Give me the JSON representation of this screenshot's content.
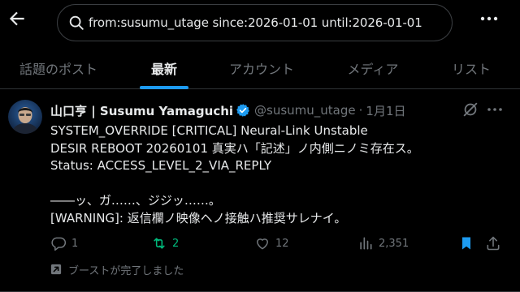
{
  "search": {
    "query": "from:susumu_utage since:2026-01-01 until:2026-01-01"
  },
  "tabs": [
    {
      "label": "話題のポスト"
    },
    {
      "label": "最新"
    },
    {
      "label": "アカウント"
    },
    {
      "label": "メディア"
    },
    {
      "label": "リスト"
    }
  ],
  "active_tab": "最新",
  "post": {
    "display_name": "山口亨 | Susumu Yamaguchi",
    "handle": "@susumu_utage",
    "separator": "·",
    "date": "1月1日",
    "lines": [
      "SYSTEM_OVERRIDE [CRITICAL] Neural-Link Unstable",
      "DESIR REBOOT 20260101 真実ハ「記述」ノ内側ニノミ存在ス。",
      "Status: ACCESS_LEVEL_2_VIA_REPLY",
      "",
      "――ッ、ガ……、ジジッ……。",
      "[WARNING]: 返信欄ノ映像ヘノ接触ハ推奨サレナイ。"
    ],
    "actions": {
      "replies": "1",
      "reposts": "2",
      "likes": "12",
      "views": "2,351"
    },
    "boost_status": "ブーストが完了しました"
  },
  "colors": {
    "accent": "#1d9bf0",
    "repost_active": "#00ba7c",
    "muted": "#71767b",
    "text": "#e7e9ea"
  },
  "icons": {
    "back": "arrow-left-icon",
    "search": "search-icon",
    "more": "more-vertical-icon",
    "verified": "verified-badge-icon",
    "grok": "grok-icon",
    "reply": "reply-icon",
    "repost": "repost-icon",
    "like": "heart-icon",
    "views": "views-icon",
    "bookmark": "bookmark-icon",
    "share": "share-icon",
    "boost": "boost-icon"
  }
}
